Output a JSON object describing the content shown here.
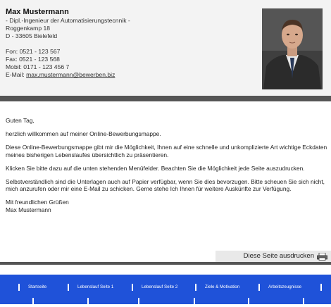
{
  "profile": {
    "name": "Max Mustermann",
    "title": "- Dipl.-Ingenieur der Automatisierungstecnnik -",
    "street": "Roggenkamp 18",
    "city": "D - 33605 Bielefeld",
    "phone": "Fon: 0521 - 123 567",
    "fax": "Fax: 0521 - 123 568",
    "mobile": "Mobil: 0171 - 123 456 7",
    "email_label": "E-Mail: ",
    "email": "max.mustermann@bewerben.biz"
  },
  "letter": {
    "greeting": "Guten Tag,",
    "welcome": "herzlich willkommen auf meiner Online-Bewerbungsmappe.",
    "p1": "Diese Online-Bewerbungsmappe gibt mir die Möglichkeit, Ihnen auf eine schnelle und unkomplizierte Art wichtige Eckdaten meines bisherigen Lebenslaufes übersichtlich zu präsentieren.",
    "p2": "Klicken Sie bitte dazu auf die unten stehenden Menüfelder. Beachten Sie die Möglichkeit jede Seite auszudrucken.",
    "p3": "Selbstverständlich sind die Unterlagen auch auf Papier verfügbar, wenn Sie dies bevorzugen. Bitte scheuen Sie sich nicht, mich anzurufen oder mir eine E-Mail zu schicken. Gerne stehe Ich Ihnen für weitere Auskünfte zur Verfügung.",
    "closing": "Mit freundlichen Grüßen",
    "signature": "Max Mustermann"
  },
  "print": {
    "label": "Diese Seite ausdrucken",
    "icon": "printer-icon"
  },
  "nav": {
    "row1": [
      "Startseite",
      "Lebenslauf Seite 1",
      "Lebenslauf Seite 2",
      "Ziele & Motivation",
      "Arbeitszeugnisse"
    ]
  },
  "colors": {
    "nav_bg": "#1f52d9",
    "bar": "#555555",
    "header_bg": "#f3f3f3"
  }
}
